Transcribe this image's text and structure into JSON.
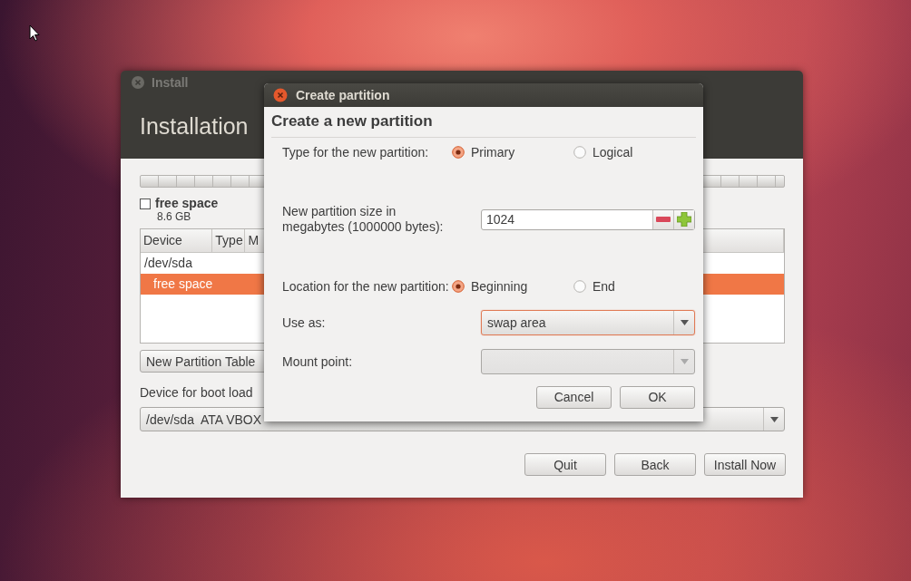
{
  "install_window": {
    "title": "Install",
    "heading": "Installation",
    "legend": {
      "label": "free space",
      "size": "8.6 GB"
    },
    "table": {
      "columns": [
        "Device",
        "Type",
        "M"
      ],
      "rows": [
        {
          "device": "/dev/sda",
          "selected": false,
          "children": [
            {
              "device": "free space",
              "selected": true
            }
          ]
        }
      ]
    },
    "new_table_button": "New Partition Table",
    "boot_loader": {
      "label": "Device for boot load",
      "value": "/dev/sda  ATA VBOX"
    },
    "buttons": [
      "Quit",
      "Back",
      "Install Now"
    ]
  },
  "dialog": {
    "title": "Create partition",
    "heading": "Create a new partition",
    "type": {
      "label": "Type for the new partition:",
      "options": [
        {
          "label": "Primary",
          "selected": true
        },
        {
          "label": "Logical",
          "selected": false
        }
      ]
    },
    "size": {
      "label": "New partition size in megabytes (1000000 bytes):",
      "value": "1024"
    },
    "location": {
      "label": "Location for the new partition:",
      "options": [
        {
          "label": "Beginning",
          "selected": true
        },
        {
          "label": "End",
          "selected": false
        }
      ]
    },
    "use_as": {
      "label": "Use as:",
      "value": "swap area"
    },
    "mount_point": {
      "label": "Mount point:",
      "disabled": true
    },
    "buttons": [
      "Cancel",
      "OK"
    ]
  }
}
